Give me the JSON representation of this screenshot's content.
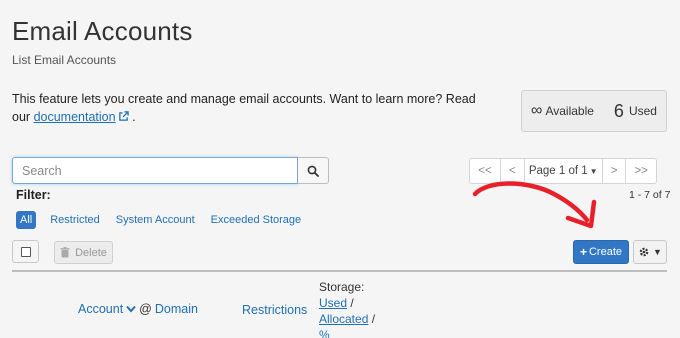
{
  "header": {
    "title": "Email Accounts",
    "subtitle": "List Email Accounts"
  },
  "intro": {
    "text": "This feature lets you create and manage email accounts. Want to learn more? Read our",
    "link_label": "documentation",
    "suffix": "."
  },
  "stats": {
    "available_symbol": "∞",
    "available_label": "Available",
    "used_count": "6",
    "used_label": "Used"
  },
  "search": {
    "placeholder": "Search",
    "value": ""
  },
  "pagination": {
    "first": "<<",
    "prev": "<",
    "page_select": "Page 1 of 1",
    "next": ">",
    "last": ">>",
    "count": "1 - 7 of 7"
  },
  "filter": {
    "label": "Filter:",
    "options": [
      "All",
      "Restricted",
      "System Account",
      "Exceeded Storage"
    ],
    "active": "All"
  },
  "toolbar": {
    "delete_label": "Delete",
    "create_label": "Create"
  },
  "table": {
    "col_account": "Account",
    "col_domain": "Domain",
    "col_at": "@",
    "col_restrictions": "Restrictions",
    "col_storage_label": "Storage:",
    "col_storage_used": "Used",
    "col_storage_allocated": "Allocated",
    "col_storage_percent": "%",
    "separator": "/"
  },
  "colors": {
    "primary": "#3277c5",
    "link": "#1f6fb4",
    "annotation_arrow": "#e8202a",
    "background": "#f5f5f5"
  }
}
